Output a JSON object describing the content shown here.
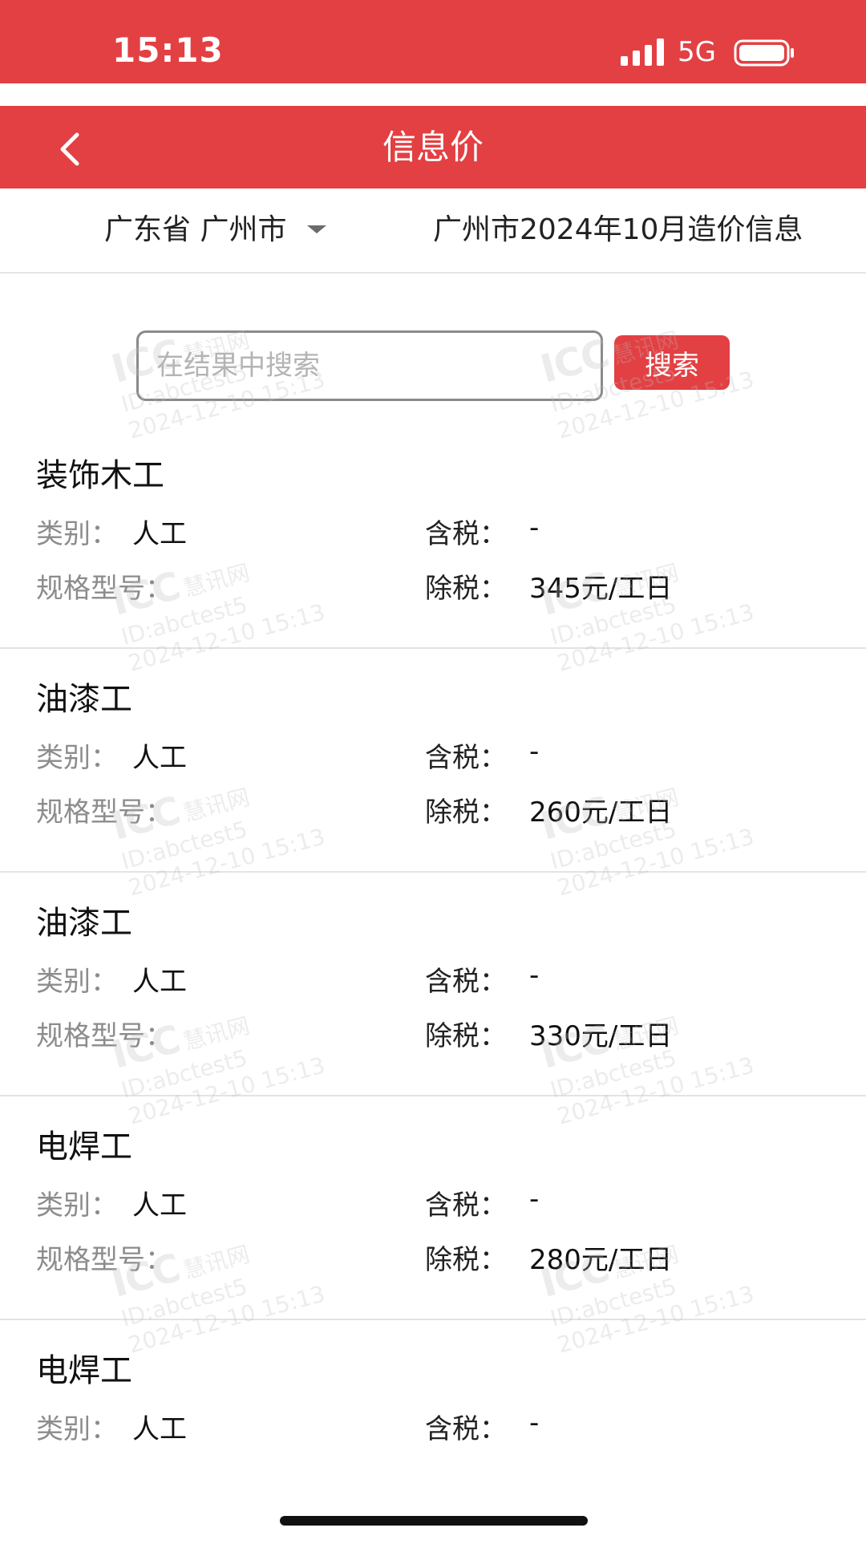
{
  "status": {
    "time": "15:13",
    "network": "5G"
  },
  "header": {
    "title": "信息价"
  },
  "filters": {
    "region": "广东省 广州市",
    "period": "广州市2024年10月造价信息"
  },
  "search": {
    "placeholder": "在结果中搜索",
    "button_label": "搜索"
  },
  "labels": {
    "category": "类别：",
    "spec": "规格型号：",
    "tax_incl": "含税：",
    "tax_excl": "除税："
  },
  "items": [
    {
      "name": "装饰木工",
      "category": "人工",
      "tax_incl": "-",
      "tax_excl": "345元/工日"
    },
    {
      "name": "油漆工",
      "category": "人工",
      "tax_incl": "-",
      "tax_excl": "260元/工日"
    },
    {
      "name": "油漆工",
      "category": "人工",
      "tax_incl": "-",
      "tax_excl": "330元/工日"
    },
    {
      "name": "电焊工",
      "category": "人工",
      "tax_incl": "-",
      "tax_excl": "280元/工日"
    },
    {
      "name": "电焊工",
      "category": "人工",
      "tax_incl": "-"
    }
  ],
  "watermark": {
    "logo": "ICC",
    "brand": "慧讯网",
    "id": "ID:abctest5",
    "timestamp": "2024-12-10 15:13"
  },
  "colors": {
    "primary": "#e24043"
  }
}
